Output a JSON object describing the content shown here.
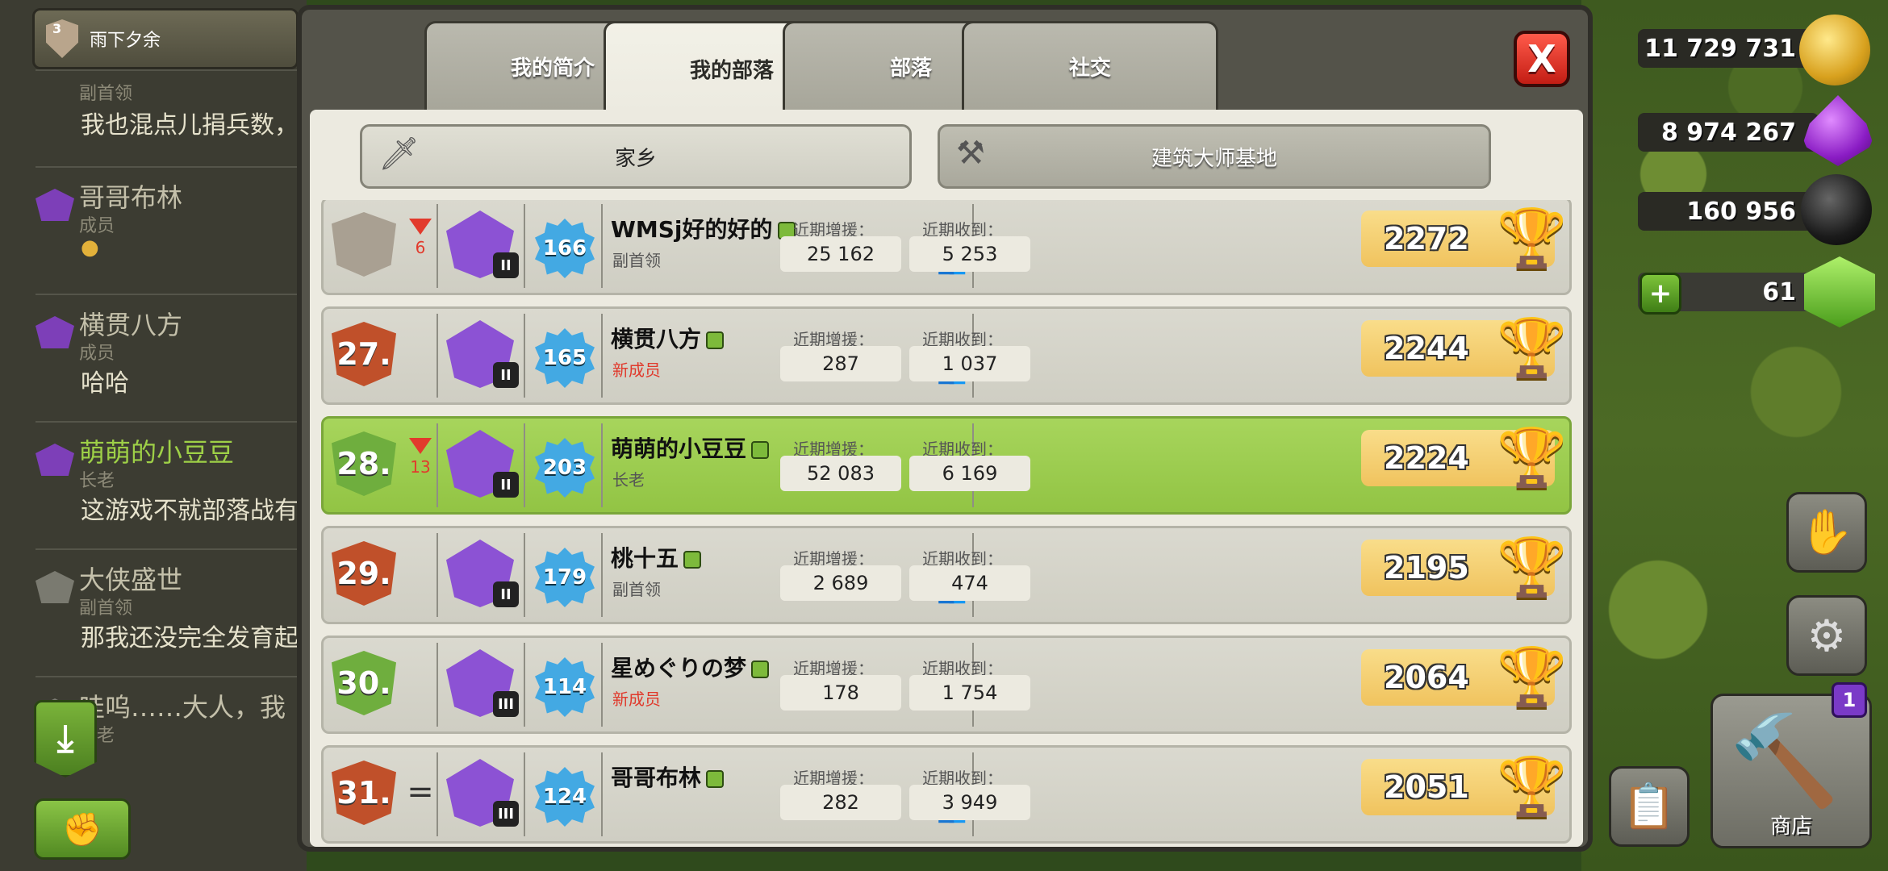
{
  "chat": {
    "header_name": "雨下夕余",
    "header_level": "3",
    "messages": [
      {
        "author": "",
        "role": "副首领",
        "text": "我也混点儿捐兵数，"
      },
      {
        "author": "哥哥布林",
        "role": "成员",
        "text": ""
      },
      {
        "author": "横贯八方",
        "role": "成员",
        "text": "哈哈"
      },
      {
        "author": "萌萌的小豆豆",
        "role": "长老",
        "text": "这游戏不就部落战有"
      },
      {
        "author": "大侠盛世",
        "role": "副首领",
        "text": "那我还没完全发育起"
      },
      {
        "author": "哇呜……大人，我",
        "role": "长老",
        "text": ""
      }
    ]
  },
  "tabs": [
    {
      "label": "我的简介"
    },
    {
      "label": "我的部落"
    },
    {
      "label": "部落"
    },
    {
      "label": "社交"
    }
  ],
  "close_label": "X",
  "subtabs": {
    "home": "家乡",
    "builder": "建筑大师基地"
  },
  "stat_labels": {
    "donated": "近期增援：",
    "received": "近期收到："
  },
  "members": [
    {
      "rank": "",
      "change": "6",
      "change_dir": "down",
      "league_tier": "II",
      "level": "166",
      "name": "WMSj好的好的",
      "role": "副首领",
      "role_type": "normal",
      "donated": "25 162",
      "received": "5 253",
      "trophies": "2272",
      "highlight": false,
      "friends": true
    },
    {
      "rank": "27.",
      "change": "",
      "change_dir": "none",
      "league_tier": "II",
      "level": "165",
      "name": "横贯八方",
      "role": "新成员",
      "role_type": "new",
      "donated": "287",
      "received": "1 037",
      "trophies": "2244",
      "highlight": false,
      "friends": true
    },
    {
      "rank": "28.",
      "change": "13",
      "change_dir": "down",
      "league_tier": "II",
      "level": "203",
      "name": "萌萌的小豆豆",
      "role": "长老",
      "role_type": "normal",
      "donated": "52 083",
      "received": "6 169",
      "trophies": "2224",
      "highlight": true,
      "friends": false
    },
    {
      "rank": "29.",
      "change": "",
      "change_dir": "none",
      "league_tier": "II",
      "level": "179",
      "name": "桃十五",
      "role": "副首领",
      "role_type": "normal",
      "donated": "2 689",
      "received": "474",
      "trophies": "2195",
      "highlight": false,
      "friends": true
    },
    {
      "rank": "30.",
      "change": "",
      "change_dir": "none",
      "league_tier": "III",
      "level": "114",
      "name": "星めぐりの梦",
      "role": "新成员",
      "role_type": "new",
      "donated": "178",
      "received": "1 754",
      "trophies": "2064",
      "highlight": false,
      "friends": false
    },
    {
      "rank": "31.",
      "change": "=",
      "change_dir": "same",
      "league_tier": "III",
      "level": "124",
      "name": "哥哥布林",
      "role": "",
      "role_type": "normal",
      "donated": "282",
      "received": "3 949",
      "trophies": "2051",
      "highlight": false,
      "friends": true
    }
  ],
  "resources": {
    "gold": "11 729 731",
    "elixir": "8 974 267",
    "dark_elixir": "160 956",
    "gems": "61"
  },
  "shop": {
    "label": "商店",
    "badge": "1"
  },
  "colors": {
    "highlight_row": "#a7d55c",
    "new_member_role": "#e03a2c",
    "close_button": "#e0342a",
    "trophy_box": "#f4cb6b"
  }
}
